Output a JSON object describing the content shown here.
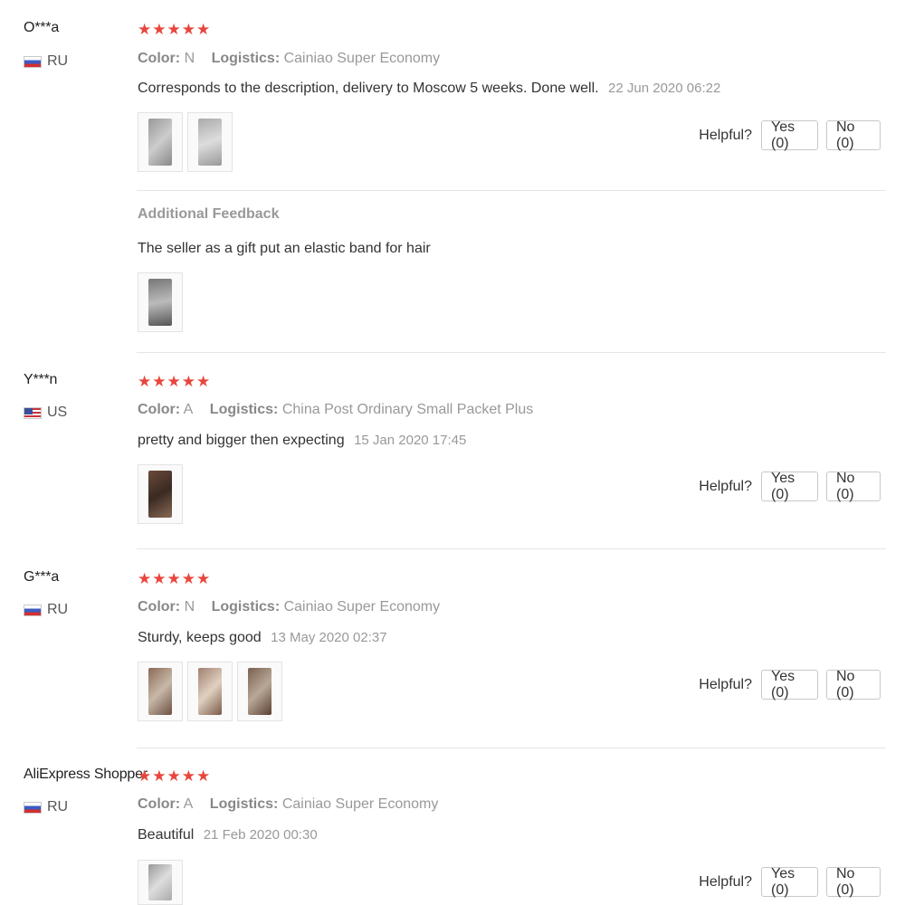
{
  "colors": {
    "star": "#e8463d",
    "muted": "#999999",
    "border": "#e6e6e6"
  },
  "helpful_label": "Helpful?",
  "meta_labels": {
    "color": "Color:",
    "logistics": "Logistics:"
  },
  "reviews": [
    {
      "user": "O***a",
      "country": "RU",
      "flag": "ru-flag-icon",
      "stars": "★★★★★",
      "rating": 5,
      "color": "N",
      "logistics": "Cainiao Super Economy",
      "text": "Corresponds to the description, delivery to Moscow 5 weeks. Done well.",
      "date": "22 Jun 2020 06:22",
      "yes": "Yes (0)",
      "no": "No (0)",
      "additional": {
        "title": "Additional Feedback",
        "text": "The seller as a gift put an elastic band for hair"
      }
    },
    {
      "user": "Y***n",
      "country": "US",
      "flag": "us-flag-icon",
      "stars": "★★★★★",
      "rating": 5,
      "color": "A",
      "logistics": "China Post Ordinary Small Packet Plus",
      "text": "pretty and bigger then expecting",
      "date": "15 Jan 2020 17:45",
      "yes": "Yes (0)",
      "no": "No (0)"
    },
    {
      "user": "G***a",
      "country": "RU",
      "flag": "ru-flag-icon",
      "stars": "★★★★★",
      "rating": 5,
      "color": "N",
      "logistics": "Cainiao Super Economy",
      "text": "Sturdy, keeps good",
      "date": "13 May 2020 02:37",
      "yes": "Yes (0)",
      "no": "No (0)"
    },
    {
      "user": "AliExpress Shopper",
      "country": "RU",
      "flag": "ru-flag-icon",
      "stars": "★★★★★",
      "rating": 5,
      "color": "A",
      "logistics": "Cainiao Super Economy",
      "text": "Beautiful",
      "date": "21 Feb 2020 00:30",
      "yes": "Yes (0)",
      "no": "No (0)"
    }
  ]
}
